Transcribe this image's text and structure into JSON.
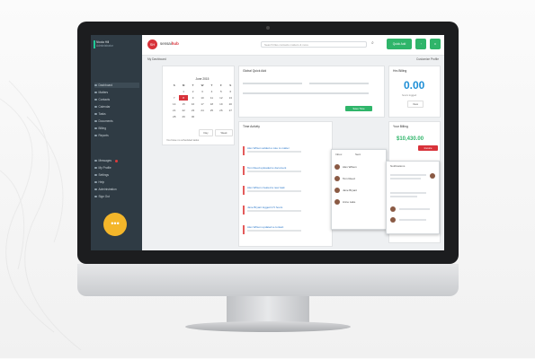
{
  "app": {
    "user_name": "Nicola Hill",
    "user_role": "Administrator",
    "logo_initials": "SH",
    "logo_text_a": "sensai",
    "logo_text_b": "hub"
  },
  "sidebar": {
    "items": [
      {
        "label": "Dashboard",
        "icon": "dashboard-icon"
      },
      {
        "label": "Matters",
        "icon": "briefcase-icon"
      },
      {
        "label": "Contacts",
        "icon": "contacts-icon"
      },
      {
        "label": "Calendar",
        "icon": "calendar-icon"
      },
      {
        "label": "Tasks",
        "icon": "tasks-icon"
      },
      {
        "label": "Documents",
        "icon": "documents-icon"
      },
      {
        "label": "Billing",
        "icon": "billing-icon"
      },
      {
        "label": "Reports",
        "icon": "reports-icon"
      }
    ],
    "items2": [
      {
        "label": "Messages",
        "icon": "messages-icon"
      },
      {
        "label": "My Profile",
        "icon": "profile-icon"
      },
      {
        "label": "Settings",
        "icon": "gear-icon"
      },
      {
        "label": "Help",
        "icon": "help-icon"
      },
      {
        "label": "Administration",
        "icon": "admin-icon"
      },
      {
        "label": "Sign Out",
        "icon": "signout-icon"
      }
    ]
  },
  "topbar": {
    "search_placeholder": "Search files contacts matters & more",
    "new_button": "Quick Add"
  },
  "subbar": {
    "left": "My Dashboard",
    "right": "Customize Profile"
  },
  "calendar": {
    "month": "June 2015",
    "days": [
      "S",
      "M",
      "T",
      "W",
      "T",
      "F",
      "S"
    ],
    "dates": [
      "",
      "1",
      "2",
      "3",
      "4",
      "5",
      "6",
      "7",
      "8",
      "9",
      "10",
      "11",
      "12",
      "13",
      "14",
      "15",
      "16",
      "17",
      "18",
      "19",
      "20",
      "21",
      "22",
      "23",
      "24",
      "25",
      "26",
      "27",
      "28",
      "29",
      "30",
      "",
      "",
      "",
      ""
    ],
    "today": "8",
    "footer": "You have no scheduled tasks",
    "btn_day": "Day",
    "btn_week": "Week"
  },
  "time_entry": {
    "title": "Global Quick Add",
    "save": "Save Time"
  },
  "unbilled": {
    "title": "Hrs Billing",
    "value": "0.00",
    "sub": "hours logged",
    "btn": "View"
  },
  "activity": {
    "title": "Time Activity",
    "items": [
      "Alex Wilson added a note to matter",
      "Tom Reed uploaded a document",
      "Alex Wilson created a new task",
      "Jane Bryant logged 2.5 hours",
      "Alex Wilson updated a contact"
    ]
  },
  "billing": {
    "title": "Your Billing",
    "outstanding": "$10,430.00",
    "btn": "Invoice"
  },
  "messages_popup": {
    "tabs": [
      "Inbox",
      "Sent"
    ],
    "people": [
      "Alex Wilson",
      "Tom Reed",
      "Jane Bryant",
      "Anne Lake"
    ]
  },
  "notes_popup": {
    "title": "Notifications"
  },
  "colors": {
    "accent": "#d8323a",
    "green": "#2fb56a",
    "sidebar": "#2f3b44"
  }
}
